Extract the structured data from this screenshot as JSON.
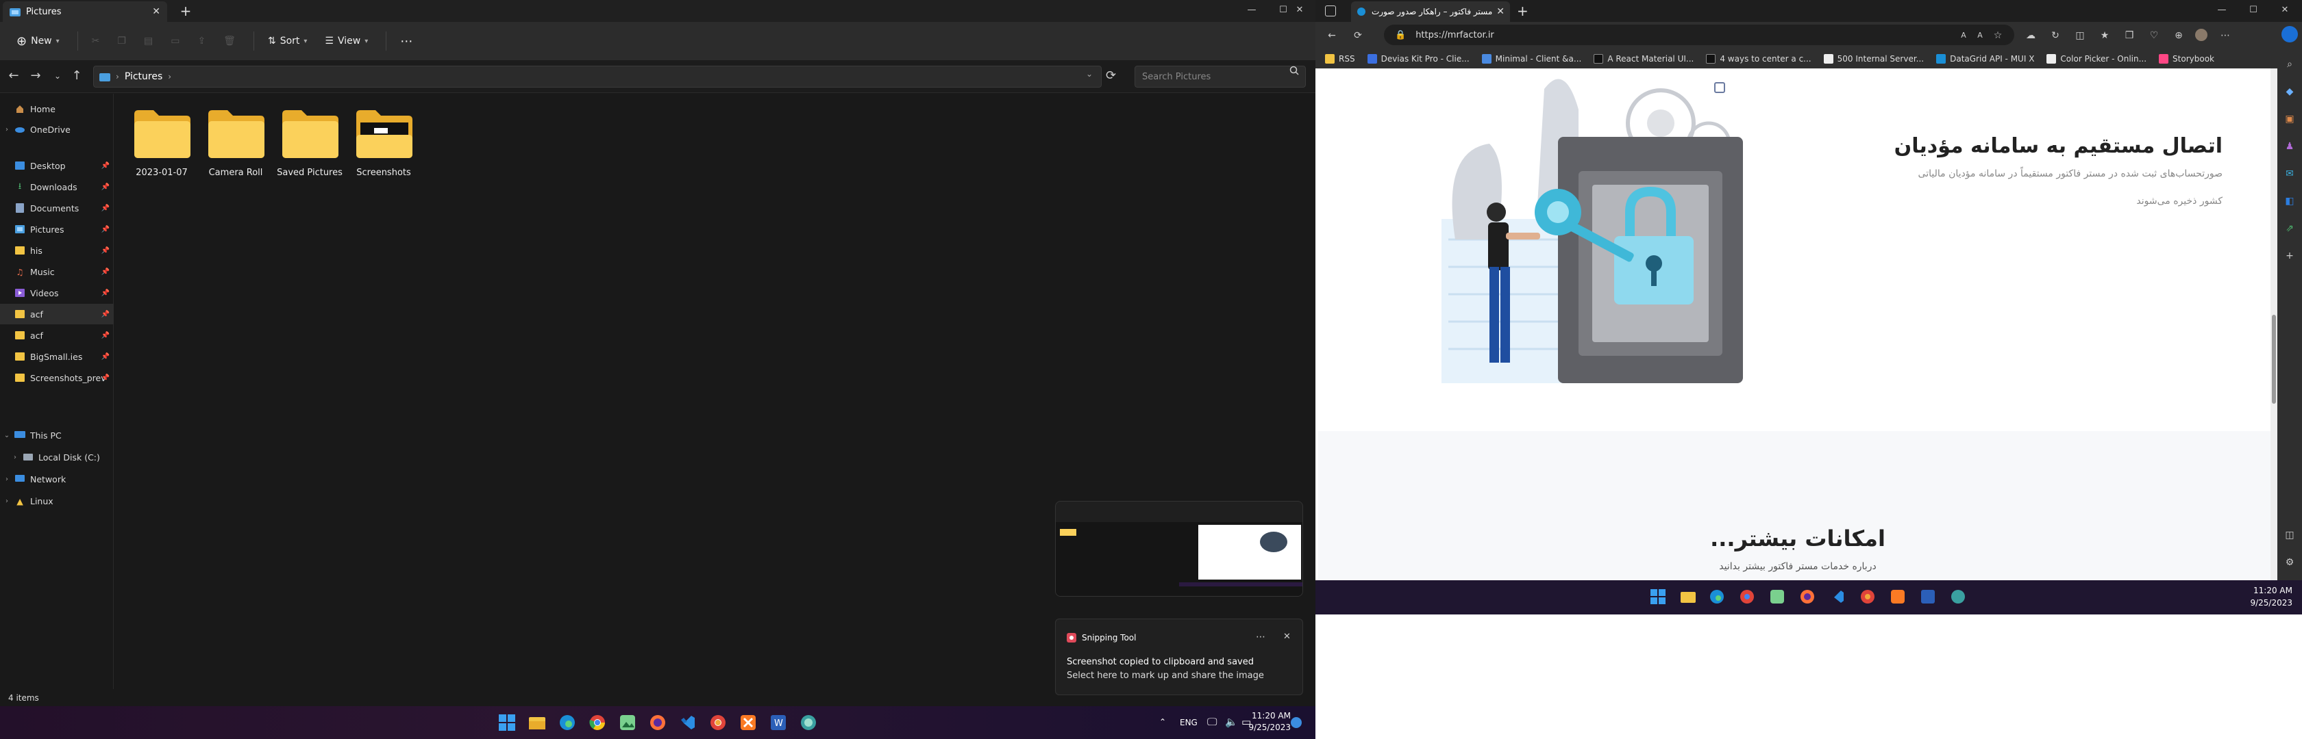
{
  "explorer": {
    "tab_title": "Pictures",
    "cmd": {
      "new": "New",
      "sort": "Sort",
      "view": "View"
    },
    "breadcrumb": "Pictures",
    "search_placeholder": "Search Pictures",
    "nav": {
      "home": "Home",
      "onedrive": "OneDrive",
      "desktop": "Desktop",
      "downloads": "Downloads",
      "documents": "Documents",
      "pictures": "Pictures",
      "his": "his",
      "music": "Music",
      "videos": "Videos",
      "acf1": "acf",
      "acf2": "acf",
      "bigsmall": "BigSmall.ies",
      "screens_prev": "Screenshots_prev",
      "thispc": "This PC",
      "localdisk": "Local Disk (C:)",
      "network": "Network",
      "linux": "Linux"
    },
    "folders": [
      "2023-01-07",
      "Camera Roll",
      "Saved Pictures",
      "Screenshots"
    ],
    "status": "4 items"
  },
  "snipping": {
    "app": "Snipping Tool",
    "line1": "Screenshot copied to clipboard and saved",
    "line2": "Select here to mark up and share the image"
  },
  "taskbar_left": {
    "lang": "ENG",
    "time": "11:20 AM",
    "date": "9/25/2023"
  },
  "edge": {
    "tab_title": "مستر فاکتور – راهکار صدور صورت...",
    "url": "https://mrfactor.ir",
    "favorites": [
      "RSS",
      "Devias Kit Pro - Clie...",
      "Minimal - Client &a...",
      "A React Material UI...",
      "4 ways to center a c...",
      "500 Internal Server...",
      "DataGrid API - MUI X",
      "Color Picker - Onlin...",
      "Storybook"
    ]
  },
  "webpage": {
    "heading": "اتصال مستقیم به سامانه مؤدیان",
    "desc1": "صورتحساب‌های ثبت شده در مستر فاکتور مستقیماً در سامانه مؤدیان مالیاتی",
    "desc2": "کشور ذخیره می‌شوند",
    "features_title": "امکانات بیشتر...",
    "features_sub": "درباره خدمات مستر فاکتور بیشتر بدانید"
  },
  "taskbar_right": {
    "time": "11:20 AM",
    "date": "9/25/2023"
  }
}
